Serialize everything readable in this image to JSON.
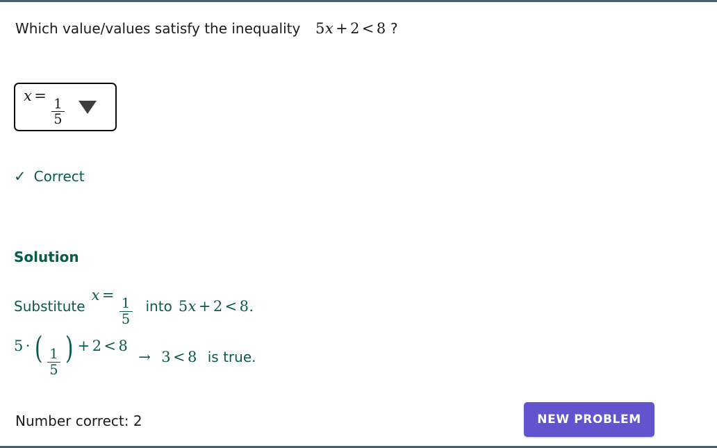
{
  "theme": {
    "rule_color": "#46606e",
    "solution_color": "#0a5a4c",
    "text_color": "#1b1b1b",
    "button_color": "#6154ce",
    "button_text_color": "#ffffff"
  },
  "question": {
    "prose_before": "Which value/values satisfy the inequality",
    "expression": {
      "coefficient": "5",
      "variable": "x",
      "plus": "+",
      "constant": "2",
      "relation": "<",
      "bound": "8"
    },
    "trailing": "?"
  },
  "answer_select": {
    "value_prefix": "x",
    "equals": "=",
    "numerator": "1",
    "denominator": "5",
    "caret_icon": "chevron-down-icon"
  },
  "feedback": {
    "icon": "check-icon",
    "icon_glyph": "✓",
    "label": "Correct"
  },
  "solution": {
    "title": "Solution",
    "line1": {
      "lead": "Substitute",
      "variable": "x",
      "equals": "=",
      "numerator": "1",
      "denominator": "5",
      "middle": "into",
      "coefficient": "5",
      "var2": "x",
      "plus": "+",
      "constant": "2",
      "relation": "<",
      "bound": "8",
      "period": "."
    },
    "line2": {
      "factor": "5",
      "dot": "·",
      "lparen": "(",
      "numerator": "1",
      "denominator": "5",
      "rparen": ")",
      "plus": "+",
      "constant": "2",
      "relation": "<",
      "bound": "8",
      "arrow": "→",
      "result_left": "3",
      "result_relation": "<",
      "result_right": "8",
      "trailing": "is true."
    }
  },
  "footer": {
    "score_label": "Number correct: 2",
    "new_problem_label": "NEW PROBLEM"
  }
}
